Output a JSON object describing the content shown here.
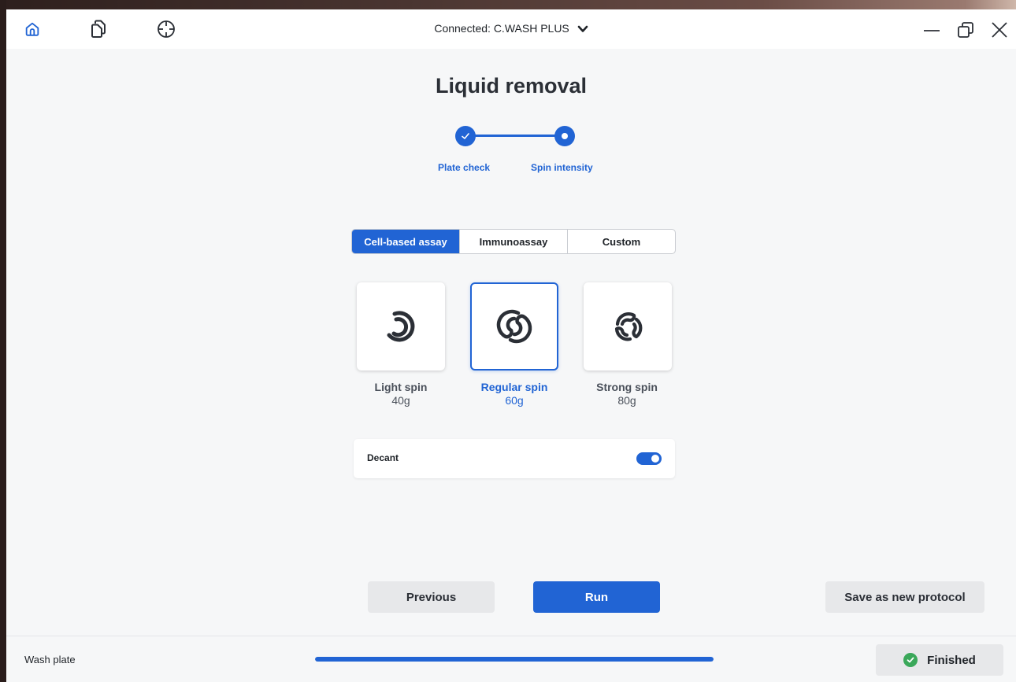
{
  "header": {
    "connected_label": "Connected: C.WASH PLUS",
    "icons": [
      "home-icon",
      "copy-icon",
      "crosshair-icon"
    ]
  },
  "page": {
    "title": "Liquid removal"
  },
  "stepper": {
    "steps": [
      {
        "label": "Plate check",
        "state": "done"
      },
      {
        "label": "Spin intensity",
        "state": "current"
      }
    ]
  },
  "assay_tabs": {
    "items": [
      "Cell-based assay",
      "Immunoassay",
      "Custom"
    ],
    "selected": "Cell-based assay"
  },
  "spin_options": [
    {
      "name": "Light spin",
      "value": "40g",
      "icon": "light-spin-icon",
      "selected": false
    },
    {
      "name": "Regular spin",
      "value": "60g",
      "icon": "regular-spin-icon",
      "selected": true
    },
    {
      "name": "Strong spin",
      "value": "80g",
      "icon": "strong-spin-icon",
      "selected": false
    }
  ],
  "decant": {
    "label": "Decant",
    "enabled": true
  },
  "actions": {
    "previous_label": "Previous",
    "run_label": "Run",
    "save_label": "Save as new protocol"
  },
  "statusbar": {
    "task_label": "Wash plate",
    "progress_fraction": 1.0,
    "status_label": "Finished"
  },
  "colors": {
    "accent": "#2164d4",
    "success": "#3aa85a",
    "background": "#f6f7f8"
  }
}
